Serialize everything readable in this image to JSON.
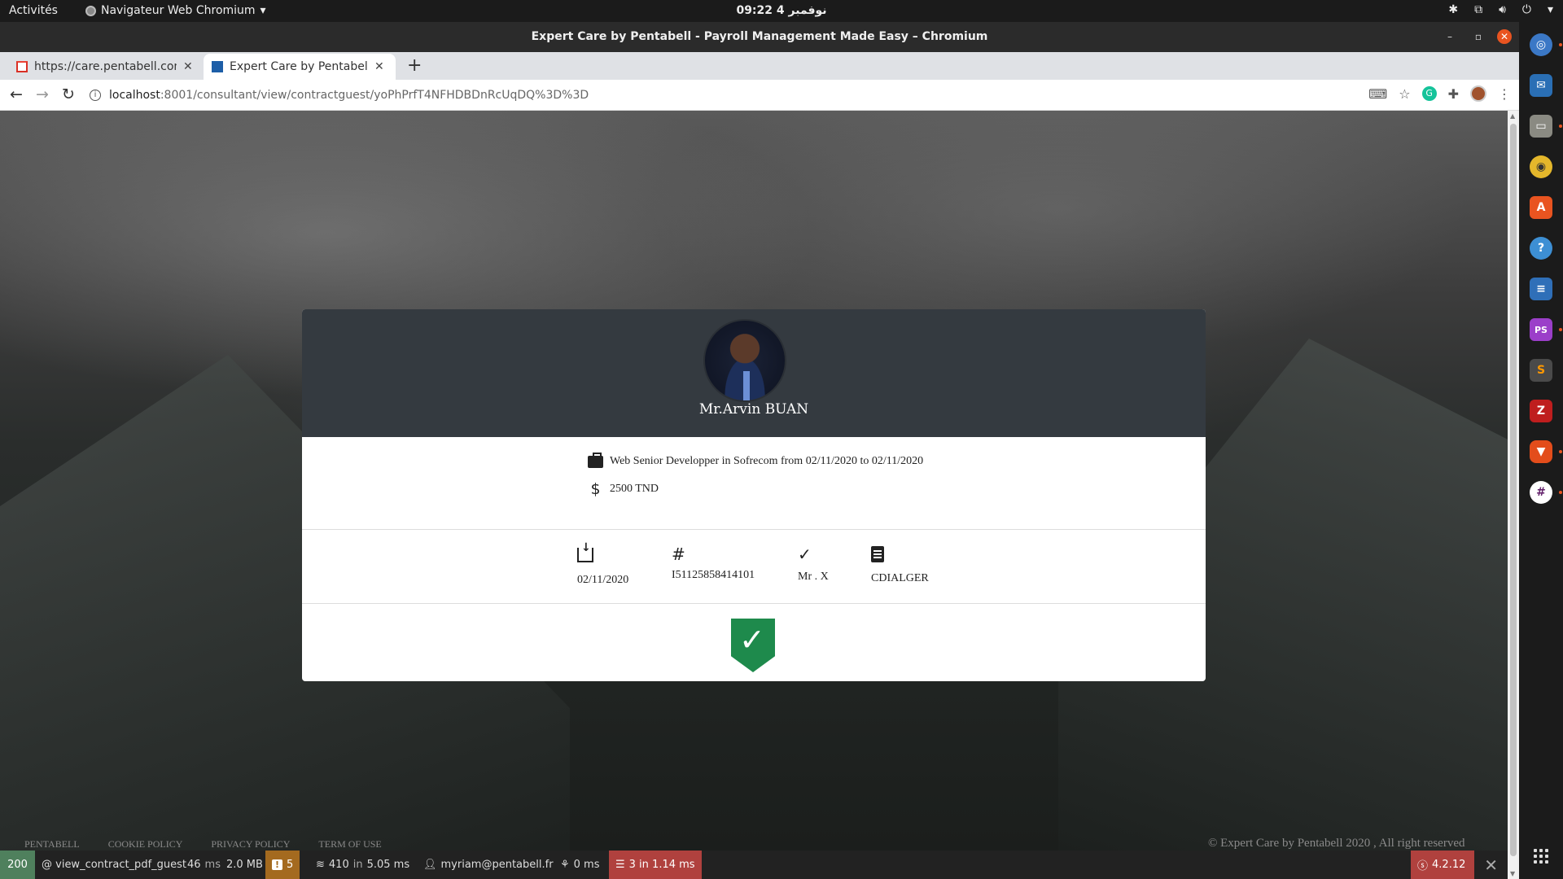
{
  "os_bar": {
    "activities": "Activités",
    "app_menu": "Navigateur Web Chromium",
    "clock": "نوفمبر 4  09:22"
  },
  "window": {
    "title": "Expert Care by Pentabell - Payroll Management Made Easy – Chromium"
  },
  "tabs": [
    {
      "title": "https://care.pentabell.com",
      "icon": "gmail-icon",
      "active": false
    },
    {
      "title": "Expert Care by Pentabell - Payroll Management Made Easy",
      "icon": "pentabell-icon",
      "active": true
    }
  ],
  "address": {
    "host": "localhost",
    "path": ":8001/consultant/view/contractguest/yoPhPrfT4NFHDBDnRcUqDQ%3D%3D"
  },
  "profile": {
    "name": "Mr.Arvin BUAN"
  },
  "contract": {
    "description": "Web Senior Developper in Sofrecom from 02/11/2020 to 02/11/2020",
    "salary": "2500 TND"
  },
  "meta": {
    "date": "02/11/2020",
    "reference": "I51125858414101",
    "validator": "Mr . X",
    "contract_type": "CDIALGER"
  },
  "footer": {
    "links": [
      "PENTABELL",
      "COOKIE POLICY",
      "PRIVACY POLICY",
      "TERM OF USE"
    ],
    "copyright": "© Expert Care by Pentabell 2020 , All right reserved"
  },
  "debug_toolbar": {
    "status": "200",
    "route": "@ view_contract_pdf_guest",
    "time": "46",
    "time_unit": "ms",
    "memory": "2.0 MB",
    "warnings": "5",
    "cache_count": "410",
    "cache_in": "in",
    "cache_time": "5.05 ms",
    "user": "myriam@pentabell.fr",
    "twig_time": "0 ms",
    "db_queries": "3 in 1.14 ms",
    "version": "4.2.12"
  },
  "colors": {
    "card_header": "#343a40",
    "shield": "#1e8a4c",
    "debug_ok": "#4f805d",
    "debug_warn": "#a46a1f",
    "debug_error": "#b0413e",
    "ubuntu_orange": "#e95420"
  }
}
